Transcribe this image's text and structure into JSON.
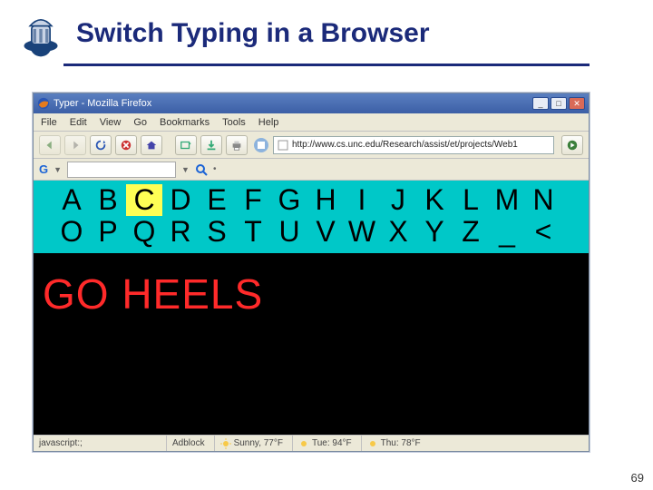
{
  "slide": {
    "title": "Switch Typing in a Browser",
    "number": "69"
  },
  "browser": {
    "window_title": "Typer - Mozilla Firefox",
    "menus": {
      "file": "File",
      "edit": "Edit",
      "view": "View",
      "go": "Go",
      "bookmarks": "Bookmarks",
      "tools": "Tools",
      "help": "Help"
    },
    "url": "http://www.cs.unc.edu/Research/assist/et/projects/Web1",
    "google_toolbar_label": "G",
    "status": {
      "left": "javascript:;",
      "adblock": "Adblock",
      "weather_now": "Sunny, 77°F",
      "weather_tue": "Tue: 94°F",
      "weather_thu": "Thu: 78°F"
    }
  },
  "app": {
    "rows": [
      [
        "A",
        "B",
        "C",
        "D",
        "E",
        "F",
        "G",
        "H",
        "I",
        "J",
        "K",
        "L",
        "M",
        "N"
      ],
      [
        "O",
        "P",
        "Q",
        "R",
        "S",
        "T",
        "U",
        "V",
        "W",
        "X",
        "Y",
        "Z",
        "_",
        "<"
      ]
    ],
    "highlight": "C",
    "output": "GO HEELS"
  }
}
